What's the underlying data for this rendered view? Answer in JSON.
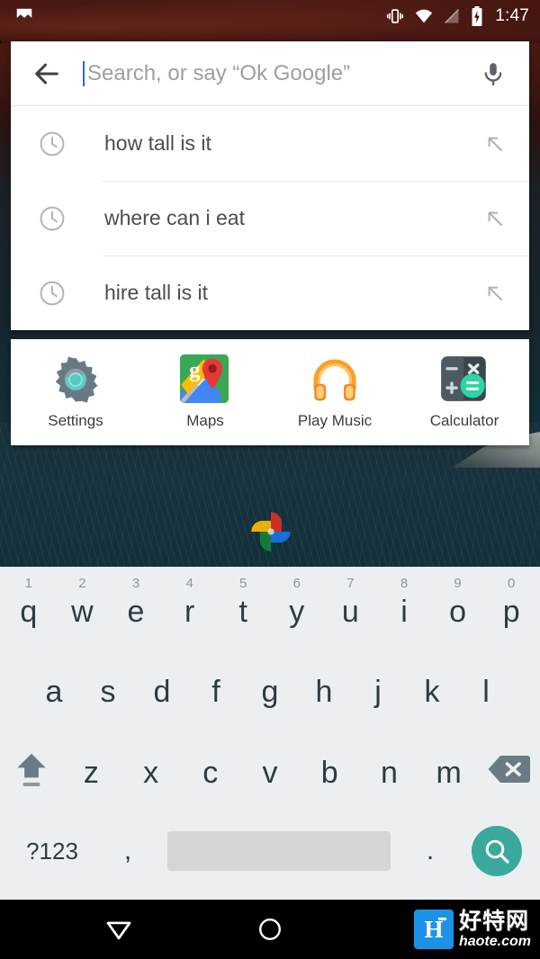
{
  "status_bar": {
    "time": "1:47",
    "icons": [
      "notification-logo-icon",
      "vibrate-icon",
      "wifi-icon",
      "no-signal-icon",
      "battery-charging-icon"
    ]
  },
  "search": {
    "back_icon": "back-arrow-icon",
    "placeholder": "Search, or say “Ok Google”",
    "value": "",
    "mic_icon": "microphone-icon",
    "caret_color": "#3367d6",
    "suggestions": [
      {
        "text": "how tall is it",
        "leading_icon": "clock-icon",
        "trailing_icon": "arrow-up-left-icon"
      },
      {
        "text": "where can i eat",
        "leading_icon": "clock-icon",
        "trailing_icon": "arrow-up-left-icon"
      },
      {
        "text": "hire tall is it",
        "leading_icon": "clock-icon",
        "trailing_icon": "arrow-up-left-icon"
      }
    ]
  },
  "app_shortcuts": [
    {
      "label": "Settings",
      "icon": "settings-gear-icon"
    },
    {
      "label": "Maps",
      "icon": "google-maps-icon"
    },
    {
      "label": "Play Music",
      "icon": "play-music-headphones-icon"
    },
    {
      "label": "Calculator",
      "icon": "calculator-icon"
    }
  ],
  "desktop": {
    "photos_icon": "google-photos-pinwheel-icon"
  },
  "keyboard": {
    "row1": [
      {
        "key": "q",
        "num": "1"
      },
      {
        "key": "w",
        "num": "2"
      },
      {
        "key": "e",
        "num": "3"
      },
      {
        "key": "r",
        "num": "4"
      },
      {
        "key": "t",
        "num": "5"
      },
      {
        "key": "y",
        "num": "6"
      },
      {
        "key": "u",
        "num": "7"
      },
      {
        "key": "i",
        "num": "8"
      },
      {
        "key": "o",
        "num": "9"
      },
      {
        "key": "p",
        "num": "0"
      }
    ],
    "row2": [
      "a",
      "s",
      "d",
      "f",
      "g",
      "h",
      "j",
      "k",
      "l"
    ],
    "row3": [
      "z",
      "x",
      "c",
      "v",
      "b",
      "n",
      "m"
    ],
    "shift_icon": "shift-icon",
    "delete_icon": "backspace-icon",
    "symbols_label": "?123",
    "comma_label": ",",
    "period_label": ".",
    "space_label": "",
    "enter_icon": "search-icon",
    "enter_color": "#3aa99b",
    "background_color": "#eceff1",
    "key_text_color": "#2d3c44"
  },
  "nav_bar": {
    "back_icon": "nav-back-triangle-icon",
    "home_icon": "nav-home-circle-icon"
  },
  "watermark": {
    "badge_letter": "H",
    "site_cn": "好特网",
    "site_domain": "haote.com",
    "badge_color": "#1d93e8"
  }
}
